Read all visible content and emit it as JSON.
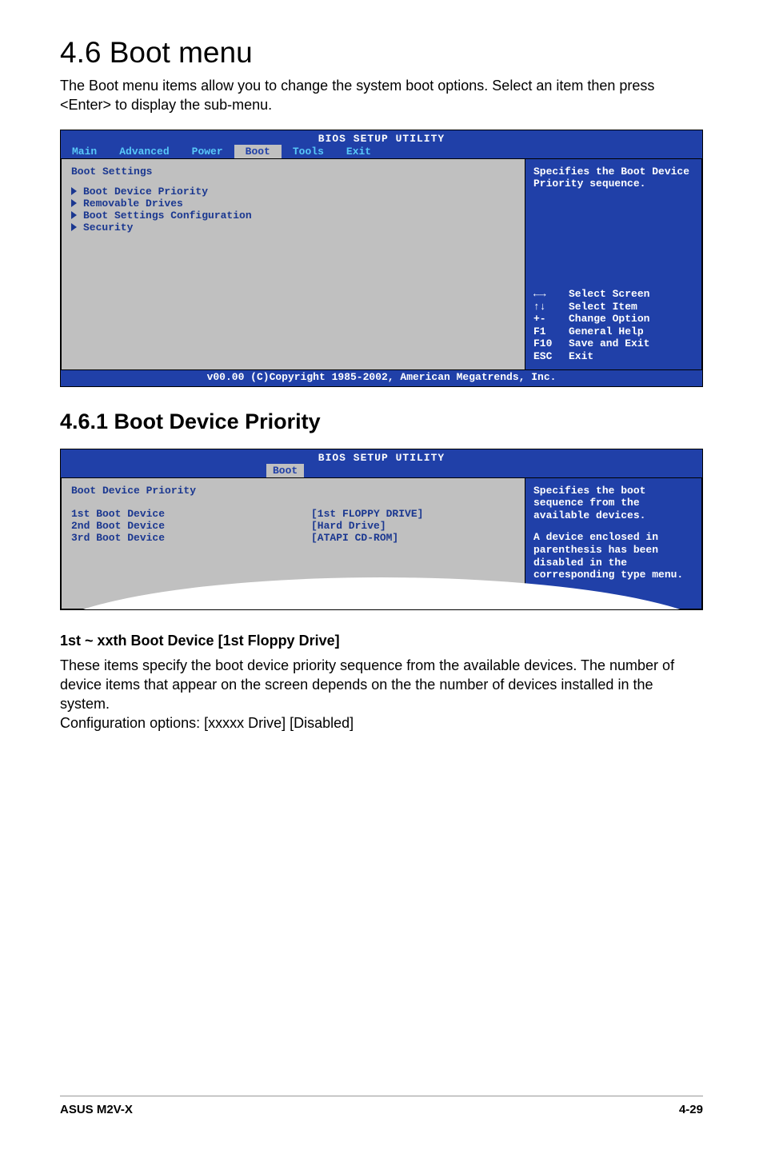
{
  "heading_main": "4.6  Boot menu",
  "intro": "The Boot menu items allow you to change the system boot options. Select an item then press <Enter> to display the sub-menu.",
  "bios1": {
    "title": "BIOS SETUP UTILITY",
    "tabs": [
      "Main",
      "Advanced",
      "Power",
      "Boot",
      "Tools",
      "Exit"
    ],
    "active_tab_index": 3,
    "panel_title": "Boot Settings",
    "options": [
      "Boot Device Priority",
      "Removable Drives",
      "Boot Settings Configuration",
      "Security"
    ],
    "help": "Specifies the Boot Device Priority sequence.",
    "legend": [
      {
        "key": "←→",
        "label": "Select Screen"
      },
      {
        "key": "↑↓",
        "label": "Select Item"
      },
      {
        "key": "+-",
        "label": "Change Option"
      },
      {
        "key": "F1",
        "label": "General Help"
      },
      {
        "key": "F10",
        "label": "Save and Exit"
      },
      {
        "key": "ESC",
        "label": "Exit"
      }
    ],
    "footer": "v00.00 (C)Copyright 1985-2002, American Megatrends, Inc."
  },
  "heading_sub_main": "4.6.1  Boot Device Priority",
  "bios2": {
    "title": "BIOS SETUP UTILITY",
    "active_tab": "Boot",
    "panel_title": "Boot Device Priority",
    "devices": [
      {
        "label": "1st Boot Device",
        "value": "[1st FLOPPY DRIVE]"
      },
      {
        "label": "2nd Boot Device",
        "value": "[Hard Drive]"
      },
      {
        "label": "3rd Boot Device",
        "value": "[ATAPI CD-ROM]"
      }
    ],
    "help1": "Specifies the boot sequence from the available devices.",
    "help2": "A device enclosed in parenthesis has been disabled in the corresponding type menu."
  },
  "section2_title": "1st ~ xxth Boot Device [1st Floppy Drive]",
  "section2_body": "These items specify the boot device priority sequence from the available devices. The number of device items that appear on the screen depends on the the number of devices installed in the system.\nConfiguration options: [xxxxx Drive] [Disabled]",
  "footer_left": "ASUS M2V-X",
  "footer_right": "4-29"
}
